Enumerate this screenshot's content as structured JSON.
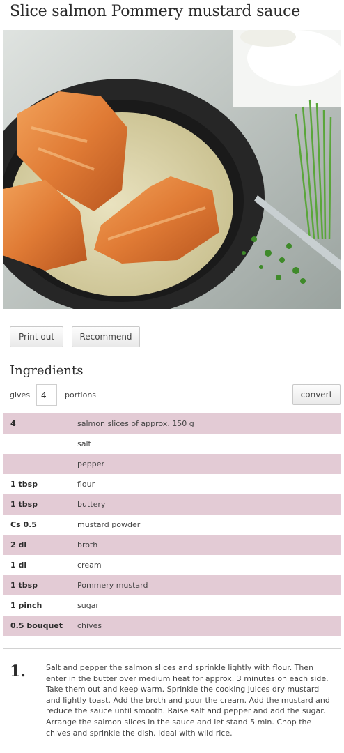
{
  "recipe": {
    "title": "Slice salmon Pommery mustard sauce"
  },
  "actions": {
    "print_label": "Print out",
    "recommend_label": "Recommend"
  },
  "ingredients": {
    "heading": "Ingredients",
    "gives_label": "gives",
    "portions_value": "4",
    "portions_label": "portions",
    "convert_label": "convert",
    "items": [
      {
        "qty": "4",
        "name": "salmon slices of approx. 150 g"
      },
      {
        "qty": "",
        "name": "salt"
      },
      {
        "qty": "",
        "name": "pepper"
      },
      {
        "qty": "1 tbsp",
        "name": "flour"
      },
      {
        "qty": "1 tbsp",
        "name": "buttery"
      },
      {
        "qty": "Cs 0.5",
        "name": "mustard powder"
      },
      {
        "qty": "2 dl",
        "name": "broth"
      },
      {
        "qty": "1 dl",
        "name": "cream"
      },
      {
        "qty": "1 tbsp",
        "name": "Pommery mustard"
      },
      {
        "qty": "1 pinch",
        "name": "sugar"
      },
      {
        "qty": "0.5 bouquet",
        "name": "chives"
      }
    ]
  },
  "steps": [
    {
      "number": "1.",
      "text": "Salt and pepper the salmon slices and sprinkle lightly with flour. Then enter in the butter over medium heat for approx. 3 minutes on each side. Take them out and keep warm. Sprinkle the cooking juices dry mustard and lightly toast. Add the broth and pour the cream. Add the mustard and reduce the sauce until smooth. Raise salt and pepper and add the sugar. Arrange the salmon slices in the sauce and let stand 5 min. Chop the chives and sprinkle the dish. Ideal with wild rice."
    }
  ],
  "colors": {
    "row_alt": "#e3cbd5",
    "divider": "#d2d2d2",
    "text": "#444444"
  }
}
